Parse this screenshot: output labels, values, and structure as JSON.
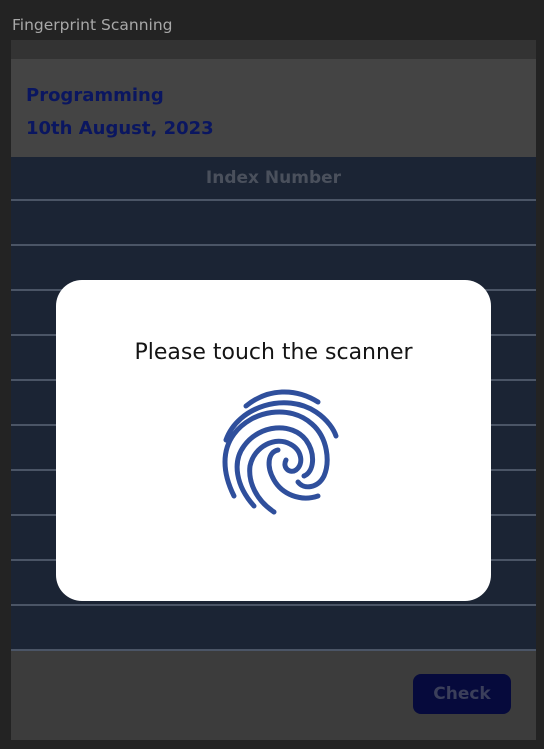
{
  "window": {
    "title": "Fingerprint Scanning"
  },
  "course": {
    "name": "Programming",
    "date": "10th August, 2023"
  },
  "table": {
    "column_header": "Index Number",
    "rows": [
      "",
      "",
      "",
      "",
      "",
      "",
      "",
      "",
      "",
      ""
    ]
  },
  "footer": {
    "check_label": "Check"
  },
  "modal": {
    "message": "Please touch the scanner",
    "icon": "fingerprint-icon",
    "icon_color": "#2f4f9c"
  },
  "colors": {
    "background": "#232323",
    "header_text": "#0a1660",
    "table_bg": "#1b2434",
    "button_bg": "#060a3c",
    "modal_bg": "#ffffff"
  }
}
